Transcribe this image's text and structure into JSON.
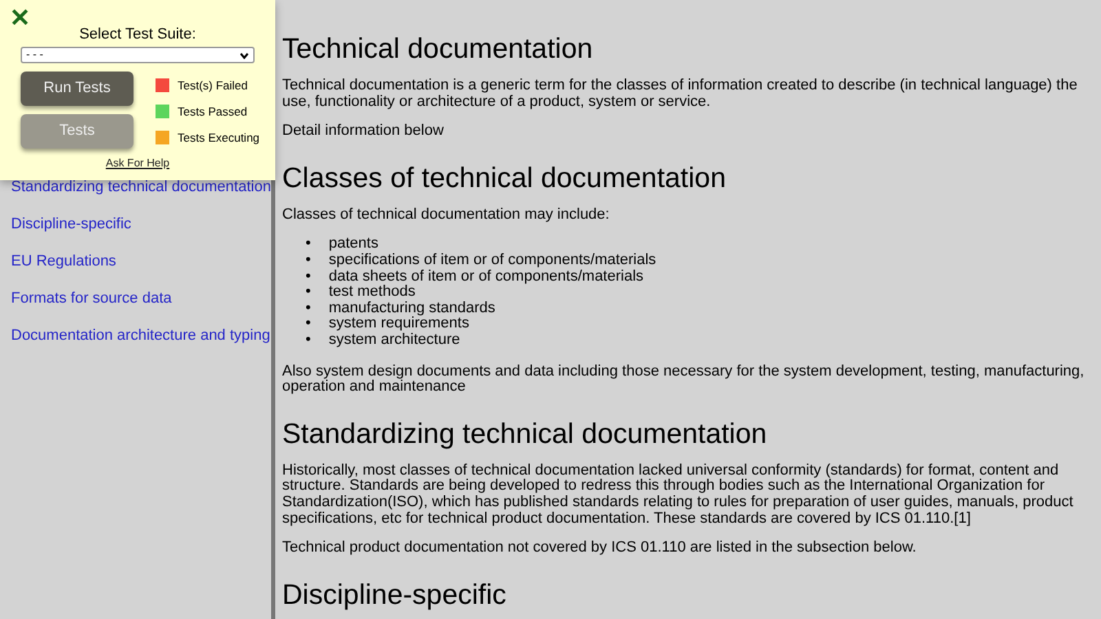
{
  "sidebar": {
    "links": [
      {
        "label": "Standardizing technical documentation"
      },
      {
        "label": "Discipline-specific"
      },
      {
        "label": "EU Regulations"
      },
      {
        "label": "Formats for source data"
      },
      {
        "label": "Documentation architecture and typing"
      }
    ]
  },
  "test_panel": {
    "close": "✕",
    "label": "Select Test Suite:",
    "select_value": "- - -",
    "buttons": [
      {
        "label": "Run Tests",
        "kind": "primary"
      },
      {
        "label": "Tests",
        "kind": "secondary"
      }
    ],
    "legend": [
      {
        "label": "Test(s) Failed",
        "color": "#f44a3e"
      },
      {
        "label": "Tests Passed",
        "color": "#5dd55d"
      },
      {
        "label": "Tests Executing",
        "color": "#f5a623"
      }
    ],
    "help_link": "Ask For Help"
  },
  "sections": [
    {
      "heading": "Technical documentation",
      "blocks": [
        {
          "kind": "p",
          "text": "Technical documentation is a generic term for the classes of information created to describe (in technical language) the use, functionality or architecture of a product, system or service."
        },
        {
          "kind": "p",
          "text": "Detail information below"
        }
      ]
    },
    {
      "heading": "Classes of technical documentation",
      "blocks": [
        {
          "kind": "p",
          "text": "Classes of technical documentation may include:"
        },
        {
          "kind": "list",
          "marker": "•",
          "items": [
            "patents",
            "specifications of item or of components/materials",
            "data sheets of item or of components/materials",
            "test methods",
            "manufacturing standards",
            "system requirements",
            "system architecture"
          ]
        },
        {
          "kind": "p",
          "text": "Also system design documents and data including those necessary for the system development, testing, manufacturing, operation and maintenance"
        }
      ]
    },
    {
      "heading": "Standardizing technical documentation",
      "blocks": [
        {
          "kind": "p",
          "text": "Historically, most classes of technical documentation lacked universal conformity (standards) for format, content and structure. Standards are being developed to redress this through bodies such as the International Organization for Standardization(ISO), which has published standards relating to rules for preparation of user guides, manuals, product specifications, etc for technical product documentation. These standards are covered by ICS 01.110.[1]"
        },
        {
          "kind": "p",
          "text": "Technical product documentation not covered by ICS 01.110 are listed in the subsection below."
        }
      ]
    },
    {
      "heading": "Discipline-specific"
    }
  ]
}
